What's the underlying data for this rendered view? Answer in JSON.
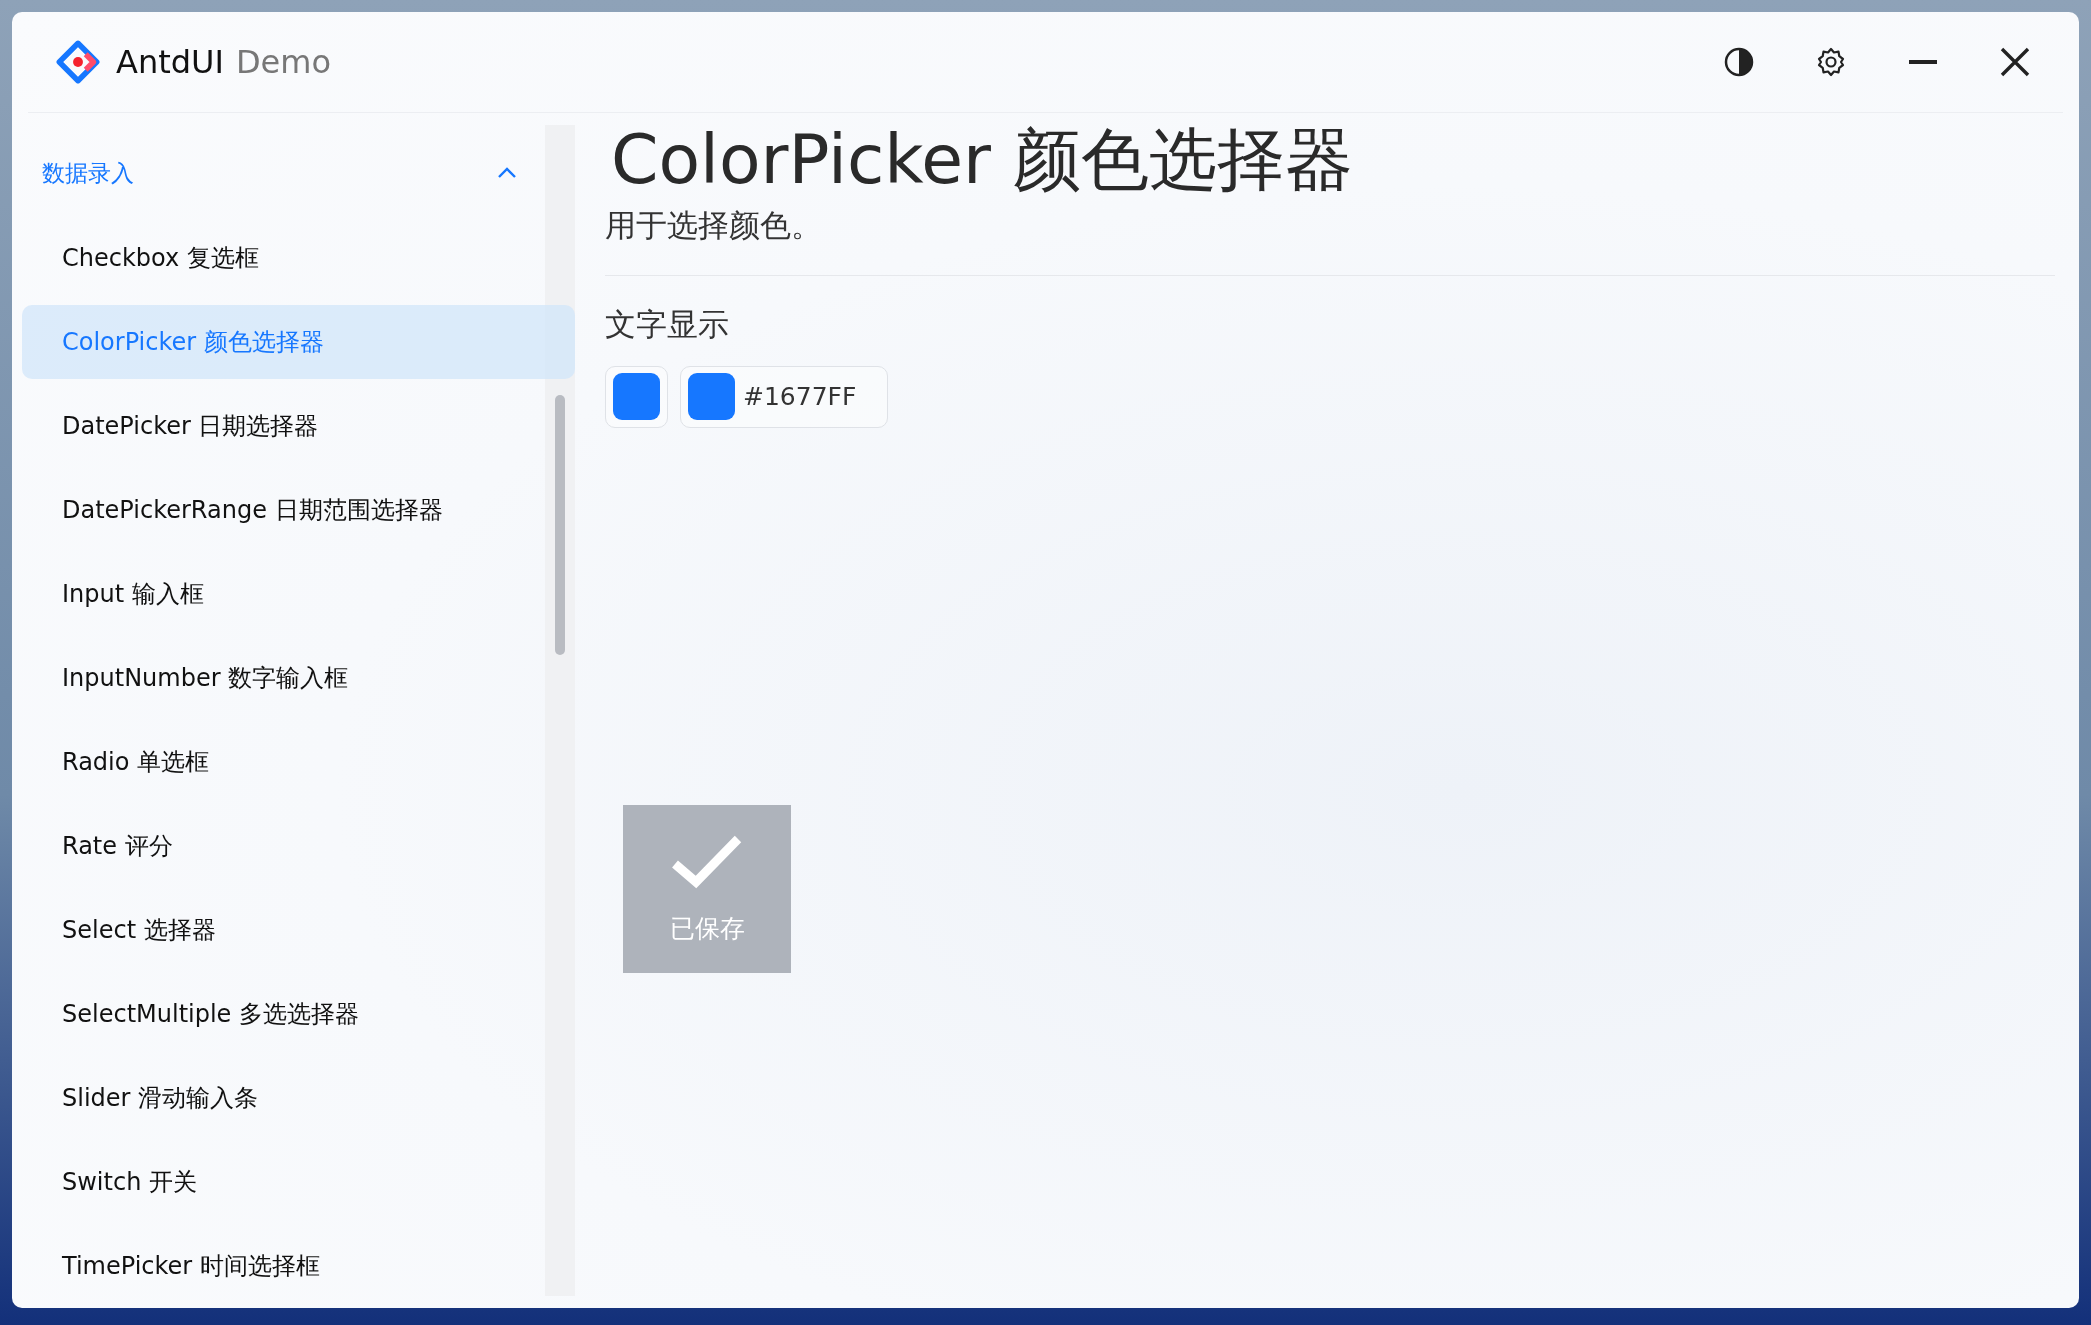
{
  "window": {
    "title": "AntdUI",
    "subtitle": "Demo"
  },
  "title_bar_buttons": [
    {
      "kind": "theme"
    },
    {
      "kind": "settings"
    },
    {
      "kind": "minimize"
    },
    {
      "kind": "close"
    }
  ],
  "sidebar": {
    "group": {
      "label": "数据录入",
      "expanded": true
    },
    "items": [
      {
        "label": "Checkbox 复选框",
        "selected": false
      },
      {
        "label": "ColorPicker 颜色选择器",
        "selected": true
      },
      {
        "label": "DatePicker 日期选择器",
        "selected": false
      },
      {
        "label": "DatePickerRange 日期范围选择器",
        "selected": false
      },
      {
        "label": "Input 输入框",
        "selected": false
      },
      {
        "label": "InputNumber 数字输入框",
        "selected": false
      },
      {
        "label": "Radio 单选框",
        "selected": false
      },
      {
        "label": "Rate 评分",
        "selected": false
      },
      {
        "label": "Select 选择器",
        "selected": false
      },
      {
        "label": "SelectMultiple 多选选择器",
        "selected": false
      },
      {
        "label": "Slider 滑动输入条",
        "selected": false
      },
      {
        "label": "Switch 开关",
        "selected": false
      },
      {
        "label": "TimePicker 时间选择框",
        "selected": false
      }
    ]
  },
  "content": {
    "title": "ColorPicker 颜色选择器",
    "description": "用于选择颜色。",
    "section": "文字显示",
    "pickers": [
      {
        "kind": "swatch",
        "color": "#1677ff"
      },
      {
        "kind": "text",
        "color": "#1677ff",
        "value": "#1677FF"
      }
    ]
  },
  "toast": {
    "message": "已保存"
  }
}
